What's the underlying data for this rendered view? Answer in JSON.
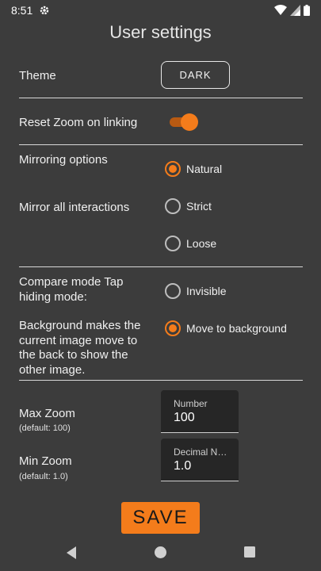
{
  "status": {
    "time": "8:51"
  },
  "title": "User settings",
  "theme": {
    "label": "Theme",
    "button": "DARK"
  },
  "reset_zoom": {
    "label": "Reset Zoom on linking",
    "enabled": true
  },
  "mirroring": {
    "label": "Mirroring options",
    "sublabel": "Mirror all interactions",
    "options": [
      "Natural",
      "Strict",
      "Loose"
    ],
    "selected": "Natural"
  },
  "compare": {
    "line1": "Compare mode Tap",
    "line2": "hiding mode:",
    "desc1": "Background makes the",
    "desc2": "current image move to",
    "desc3": "the back to show the",
    "desc4": "other image.",
    "options": [
      "Invisible",
      "Move to background"
    ],
    "selected": "Move to background"
  },
  "max_zoom": {
    "label": "Max Zoom",
    "hint": "(default: 100)",
    "field_label": "Number",
    "value": "100"
  },
  "min_zoom": {
    "label": "Min Zoom",
    "hint": "(default: 1.0)",
    "field_label": "Decimal Number",
    "value": "1.0"
  },
  "save_label": "SAVE",
  "colors": {
    "background": "#3c3c3c",
    "accent": "#f47c1b"
  },
  "nav_icons": [
    "back-icon",
    "home-icon",
    "recents-icon"
  ]
}
